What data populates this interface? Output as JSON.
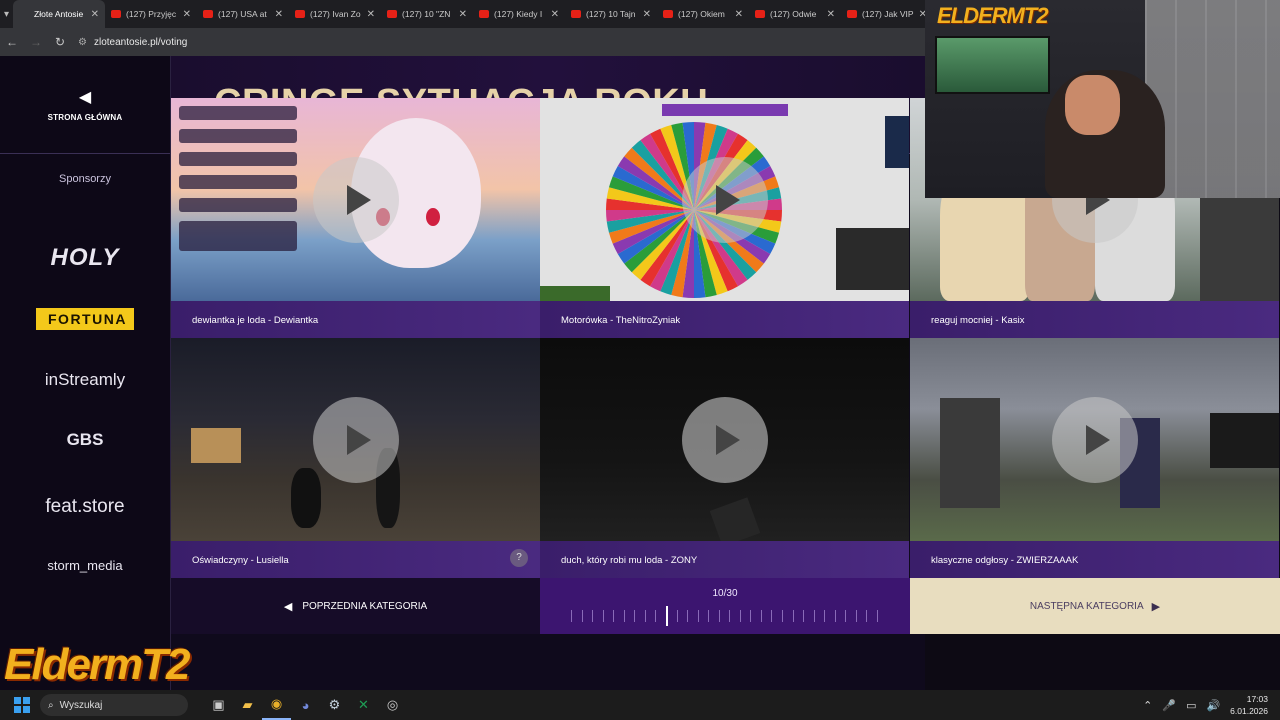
{
  "browser": {
    "tabs": [
      {
        "label": "Złote Antosie",
        "active": true,
        "icon": "site"
      },
      {
        "label": "(127) Przyjęc",
        "icon": "youtube"
      },
      {
        "label": "(127) USA at",
        "icon": "youtube"
      },
      {
        "label": "(127) Ivan Zo",
        "icon": "youtube"
      },
      {
        "label": "(127) 10 \"ZN",
        "icon": "youtube"
      },
      {
        "label": "(127) Kiedy I",
        "icon": "youtube"
      },
      {
        "label": "(127) 10 Tajn",
        "icon": "youtube"
      },
      {
        "label": "(127) Okiem",
        "icon": "youtube"
      },
      {
        "label": "(127) Odwie",
        "icon": "youtube"
      },
      {
        "label": "(127) Jak VIP",
        "icon": "youtube"
      }
    ],
    "url": "zloteantosie.pl/voting"
  },
  "sidebar": {
    "home_label": "STRONA GŁÓWNA",
    "sponsors_title": "Sponsorzy",
    "sponsors": [
      "HOLY",
      "FORTUNA",
      "inStreamly",
      "GBS",
      "feat.store",
      "storm_media"
    ]
  },
  "header": {
    "title": "CRINGE SYTUACJA ROKU"
  },
  "entries": [
    {
      "label": "dewiantka je loda - Dewiantka"
    },
    {
      "label": "Motorówka - TheNitroZyniak"
    },
    {
      "label": "reaguj mocniej - Kasix"
    },
    {
      "label": "Oświadczyny - Lusiella"
    },
    {
      "label": "duch, który robi mu loda - ZONY"
    },
    {
      "label": "klasyczne odgłosy - ZWIERZAAAK"
    }
  ],
  "footer": {
    "prev_label": "POPRZEDNIA KATEGORIA",
    "next_label": "NASTĘPNA KATEGORIA",
    "progress_label": "10/30",
    "progress_current": 10,
    "progress_total": 30
  },
  "overlay": {
    "cam_logo": "ELDERMT2",
    "stream_logo": "EldermT2"
  },
  "taskbar": {
    "search_placeholder": "Wyszukaj",
    "time": "17:03",
    "date": "6.01.2026"
  },
  "colors": {
    "title": "#e6d2a8",
    "label_bar": "#4a2a80",
    "progress_bg": "#3c1570",
    "next_bg": "#e8ddbf",
    "fortuna": "#f3c81a"
  }
}
